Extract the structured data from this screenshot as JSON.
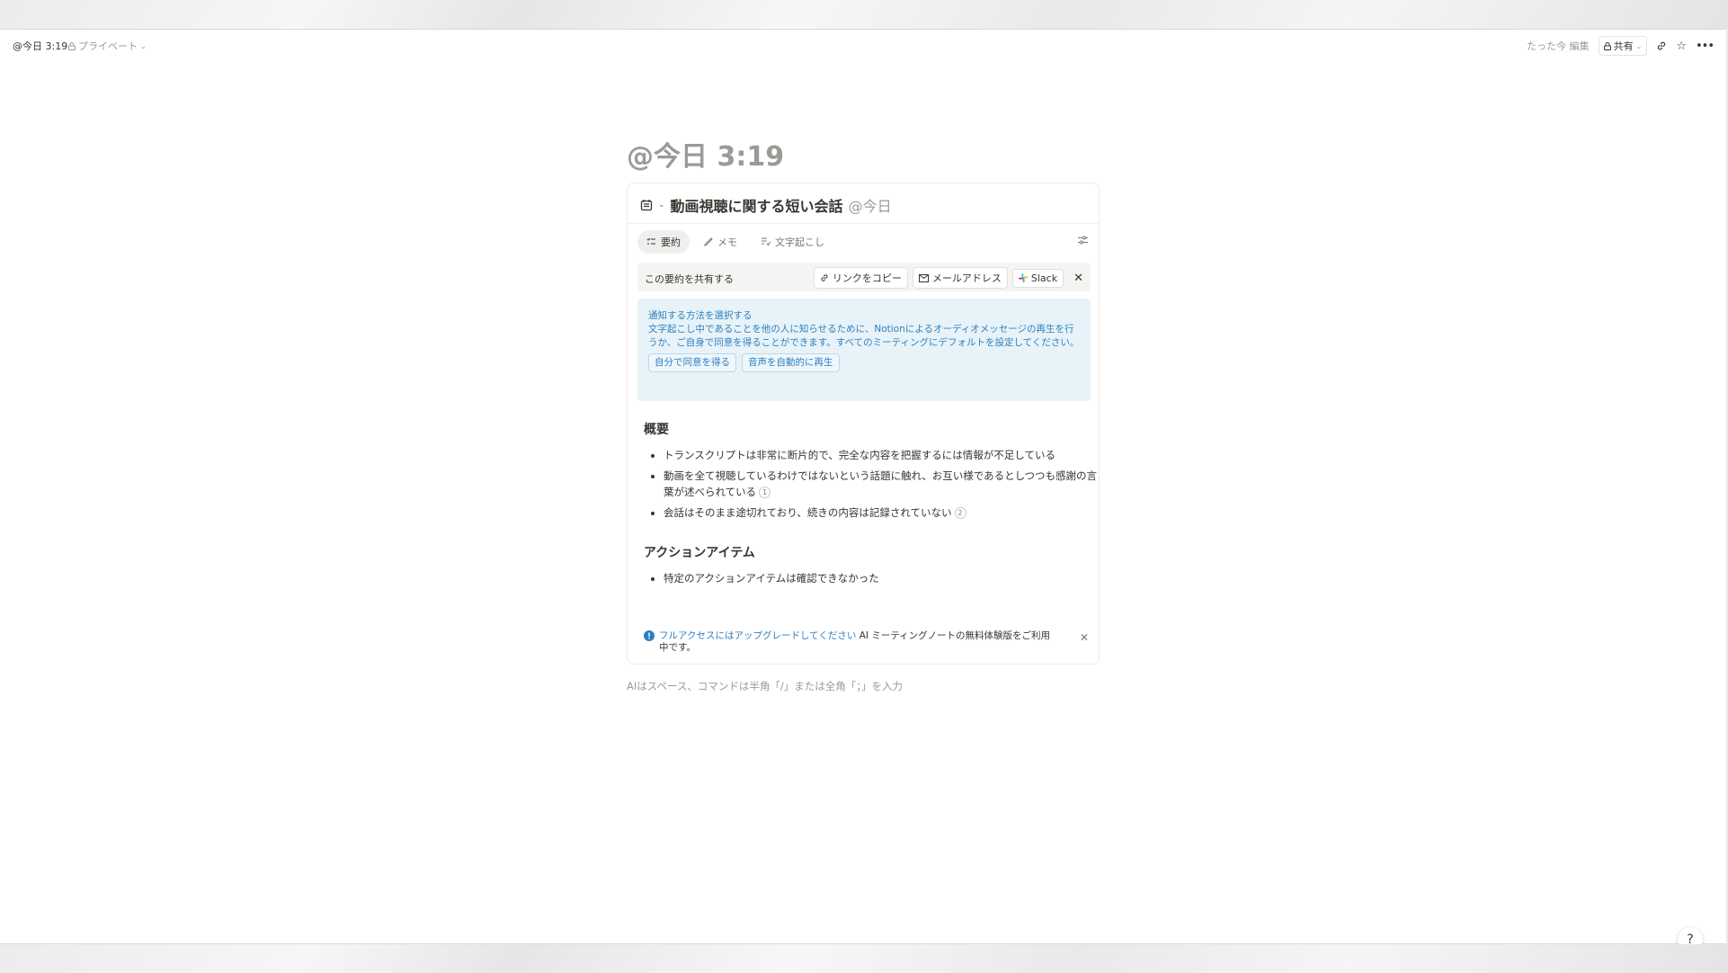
{
  "topbar": {
    "breadcrumb": "@今日 3:19",
    "privacy": "プライベート",
    "edited": "たった今 編集",
    "share": "共有"
  },
  "page": {
    "title": "@今日 3:19",
    "input_hint": "AIはスペース、コマンドは半角「/」または全角「；」を入力"
  },
  "meeting": {
    "name": "動画視聴に関する短い会話",
    "date": "@今日",
    "tabs": [
      {
        "label": "要約"
      },
      {
        "label": "メモ"
      },
      {
        "label": "文字起こし"
      }
    ],
    "share_bar": {
      "label": "この要約を共有する",
      "copy_link": "リンクをコピー",
      "email": "メールアドレス",
      "slack": "Slack"
    },
    "notice": {
      "title": "通知する方法を選択する",
      "body": "文字起こし中であることを他の人に知らせるために、Notionによるオーディオメッセージの再生を行うか、ご自身で同意を得ることができます。すべてのミーティングにデフォルトを設定してください。",
      "btn_self": "自分で同意を得る",
      "btn_auto": "音声を自動的に再生"
    },
    "summary": {
      "heading": "概要",
      "bullets": [
        "トランスクリプトは非常に断片的で、完全な内容を把握するには情報が不足している",
        "動画を全て視聴しているわけではないという話題に触れ、お互い様であるとしつつも感謝の言葉が述べられている",
        "会話はそのまま途切れており、続きの内容は記録されていない"
      ],
      "citations": [
        "1",
        "2"
      ]
    },
    "actions": {
      "heading": "アクションアイテム",
      "bullets": [
        "特定のアクションアイテムは確認できなかった"
      ]
    },
    "upgrade": {
      "link": "フルアクセスにはアップグレードしてください",
      "text": " AI ミーティングノートの無料体験版をご利用中です。"
    }
  },
  "help": {
    "label": "?"
  },
  "colors": {
    "accent": "#2f7fbf",
    "notice_bg": "#e7f3f8",
    "text": "#37352f",
    "muted": "#9b9a97"
  }
}
